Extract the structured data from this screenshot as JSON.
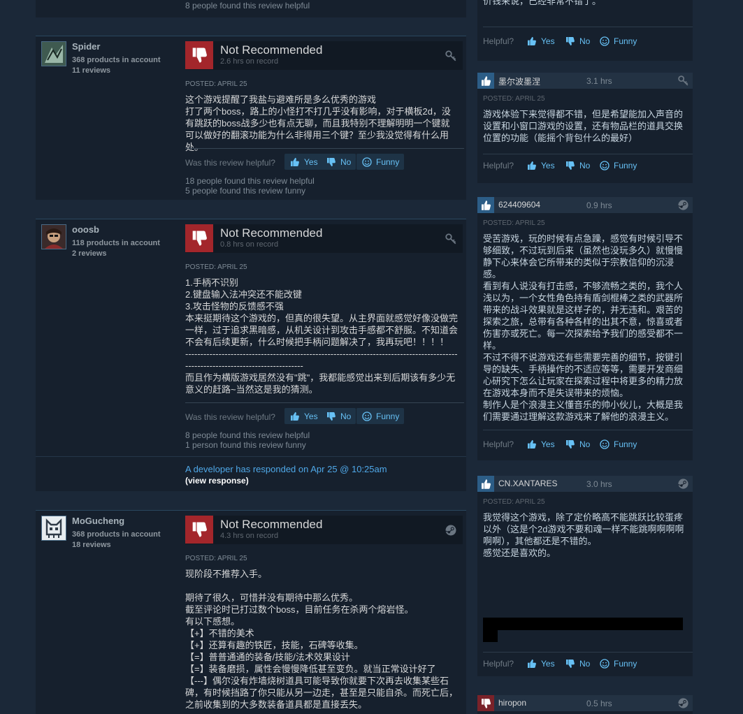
{
  "labels": {
    "not_recommended": "Not Recommended",
    "posted_prefix": "POSTED:",
    "helpful_question": "Was this review helpful?",
    "helpful_short": "Helpful?",
    "yes": "Yes",
    "no": "No",
    "funny": "Funny"
  },
  "colors": {
    "background": "#1b2838",
    "card": "#16202d",
    "thumb_down": "#a3262b",
    "thumb_up": "#2c5d86",
    "link": "#67c1f5"
  },
  "previous_review_tail": "8 people found this review helpful",
  "reviews": [
    {
      "author": "Spider",
      "products": "368 products in account",
      "reviews_count": "11 reviews",
      "verdict": "Not Recommended",
      "hours": "2.6 hrs on record",
      "posted": "POSTED: APRIL 25",
      "text": "这个游戏提醒了我盐与避难所是多么优秀的游戏\n打了两个boss，路上的小怪打不打几乎没有影响，对于横板2d，没有跳跃的boss战多少也有点无聊，而且我特别不理解明明一个键就可以做好的翻滚功能为什么非得用三个键？至少我没觉得有什么用处。",
      "helpful_found": "18 people found this review helpful",
      "funny_found": "5 people found this review funny",
      "source_icon": "key-icon"
    },
    {
      "author": "ooosb",
      "products": "118 products in account",
      "reviews_count": "2 reviews",
      "verdict": "Not Recommended",
      "hours": "0.8 hrs on record",
      "posted": "POSTED: APRIL 25",
      "text": "1.手柄不识别\n2.键盘输入法冲突还不能改键\n3.攻击怪物的反馈感不强\n本来挺期待这个游戏的，但真的很失望。从主界面就感觉好像没做完一样，过于追求黑暗感，从机关设计到攻击手感都不舒服。不知道会不会有后续更新，什么时候把手柄问题解决了，我再玩吧！！！！\n---------------------------------------------------------------------------------------------------------------------------------\n而且作为横版游戏居然没有\"跳\"，我都能感觉出来到后期该有多少无意义的赶路~当然这是我的猜测。",
      "helpful_found": "8 people found this review helpful",
      "funny_found": "1 person found this review funny",
      "source_icon": "key-icon",
      "developer_response": "A developer has responded on Apr 25 @ 10:25am",
      "view_response": "(view response)"
    },
    {
      "author": "MoGucheng",
      "products": "368 products in account",
      "reviews_count": "18 reviews",
      "verdict": "Not Recommended",
      "hours": "4.3 hrs on record",
      "posted": "POSTED: APRIL 25",
      "text": "现阶段不推荐入手。\n\n期待了很久，可惜并没有期待中那么优秀。\n截至评论时已打过数个boss，目前任务在杀两个熔岩怪。\n有以下感想。\n【+】不错的美术\n【+】还算有趣的铁匠，技能，石碑等收集。\n【=】普普通通的装备/技能/法术效果设计\n【=】装备磨损，属性会慢慢降低甚至变负。就当正常设计好了\n【---】偶尔没有炸墙烧树道具可能导致你就要下次再去收集某些石碑，有时候挡路了你只能从另一边走，甚至是只能自杀。而死亡后，之前收集到的大多数装备道具都是直接丢失。",
      "source_icon": "steam-icon"
    }
  ],
  "side_reviews": [
    {
      "tail_text": "价钱来说，已经非常不错了。",
      "author": "",
      "hours": "",
      "posted": "",
      "text": ""
    },
    {
      "author": "墨尔波墨涅",
      "hours": "3.1 hrs",
      "posted": "POSTED: APRIL 25",
      "text": "游戏体验下来觉得都不错，但是希望能加入声音的设置和小窗口游戏的设置，还有物品栏的道具交换位置的功能（能摇个背包什么的最好）",
      "recommended": true,
      "source_icon": "key-icon"
    },
    {
      "author": "624409604",
      "hours": "0.9 hrs",
      "posted": "POSTED: APRIL 25",
      "text": "受苦游戏，玩的时候有点急躁，感觉有时候引导不够细致，不过玩到后来（虽然也没玩多久）就慢慢静下心来体会它所带来的类似于宗教信仰的沉浸感。\n看到有人说没有打击感，不够流畅之类的，我个人浅以为，一个女性角色持有盾剑棍棒之类的武器所带来的战斗效果就是这样子的，并无违和。艰苦的探索之旅，总带有各种各样的出其不意，惊喜或者伤害亦或死亡。每一次探索给予我们的感受都不一样。\n不过不得不说游戏还有些需要完善的细节，按键引导的缺失、手柄操作的不适应等等，需要开发商细心研究下怎么让玩家在探索过程中将更多的精力放在游戏本身而不是失误带来的烦恼。\n制作人是个浪漫主义懂音乐的帅小伙儿，大概是我们需要通过理解这款游戏来了解他的浪漫主义。",
      "recommended": true,
      "source_icon": "steam-icon"
    },
    {
      "author": "CN.XANTARES",
      "hours": "3.0 hrs",
      "posted": "POSTED: APRIL 25",
      "text": "我觉得这个游戏，除了定价略高不能跳跃比较蛋疼以外（这是个2d游戏不要和魂一样不能跳啊啊啊啊啊啊），其他都还是不错的。\n感觉还是喜欢的。",
      "recommended": true,
      "source_icon": "steam-icon"
    },
    {
      "author": "hiropon",
      "hours": "0.5 hrs",
      "recommended": false,
      "source_icon": "steam-icon"
    }
  ]
}
